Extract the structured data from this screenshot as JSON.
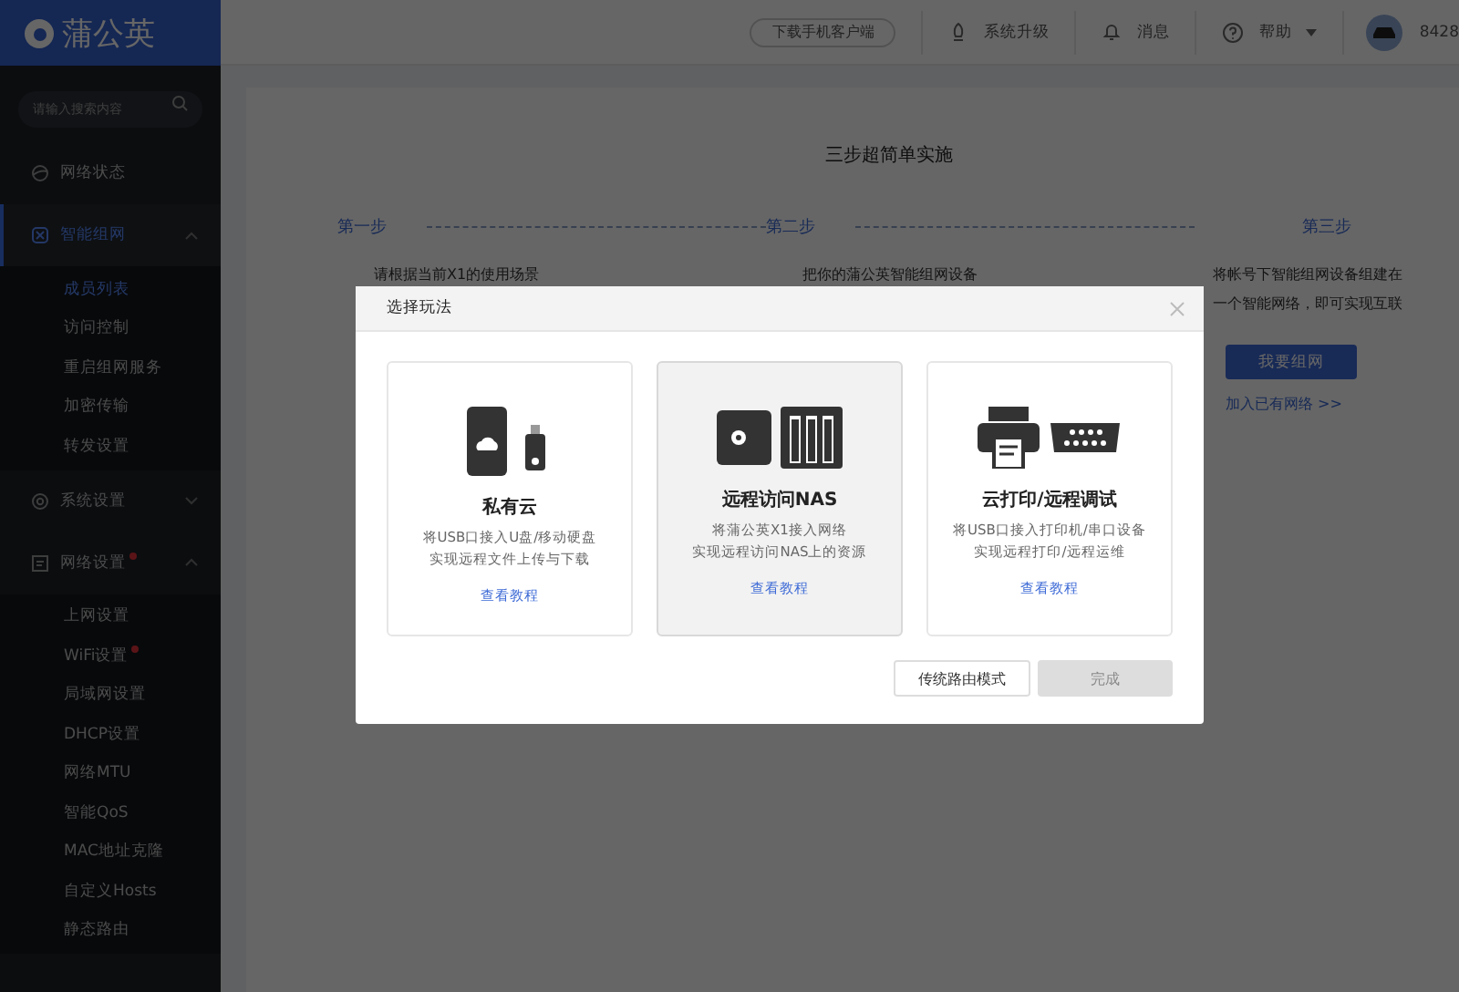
{
  "brand": {
    "name": "蒲公英"
  },
  "search": {
    "placeholder": "请输入搜索内容"
  },
  "topbar": {
    "download": "下载手机客户端",
    "items": [
      {
        "kind": "upgrade",
        "label": "系统升级"
      },
      {
        "kind": "bell",
        "label": "消息"
      },
      {
        "kind": "help",
        "label": "帮助"
      }
    ],
    "user": "8428"
  },
  "sidebar": {
    "items": [
      {
        "label": "网络状态",
        "selected": false,
        "badge": false
      },
      {
        "label": "智能组网",
        "selected": true,
        "expanded": true,
        "badge": false,
        "children": [
          {
            "label": "成员列表",
            "selected": true,
            "badge": false
          },
          {
            "label": "访问控制",
            "selected": false,
            "badge": false
          },
          {
            "label": "重启组网服务",
            "selected": false,
            "badge": false
          },
          {
            "label": "加密传输",
            "selected": false,
            "badge": false
          },
          {
            "label": "转发设置",
            "selected": false,
            "badge": false
          }
        ]
      },
      {
        "label": "系统设置",
        "selected": false,
        "expanded": false,
        "badge": false
      },
      {
        "label": "网络设置",
        "selected": false,
        "expanded": true,
        "badge": true,
        "children": [
          {
            "label": "上网设置",
            "selected": false,
            "badge": false
          },
          {
            "label": "WiFi设置",
            "selected": false,
            "badge": true
          },
          {
            "label": "局域网设置",
            "selected": false,
            "badge": false
          },
          {
            "label": "DHCP设置",
            "selected": false,
            "badge": false
          },
          {
            "label": "网络MTU",
            "selected": false,
            "badge": false
          },
          {
            "label": "智能QoS",
            "selected": false,
            "badge": false
          },
          {
            "label": "MAC地址克隆",
            "selected": false,
            "badge": false
          },
          {
            "label": "自定义Hosts",
            "selected": false,
            "badge": false
          },
          {
            "label": "静态路由",
            "selected": false,
            "badge": false
          }
        ]
      }
    ]
  },
  "main": {
    "title": "三步超简单实施",
    "steps": [
      {
        "label": "第一步",
        "lines": [
          "请根据当前X1的使用场景"
        ]
      },
      {
        "label": "第二步",
        "lines": [
          "把你的蒲公英智能组网设备"
        ]
      },
      {
        "label": "第三步",
        "lines": [
          "将帐号下智能组网设备组建在",
          "一个智能网络，即可实现互联"
        ]
      }
    ],
    "primary_button": "我要组网",
    "join_link": "加入已有网络 >>"
  },
  "dialog": {
    "title": "选择玩法",
    "cards": [
      {
        "kind": "cloud",
        "title": "私有云",
        "lines": [
          "将USB口接入U盘/移动硬盘",
          "实现远程文件上传与下载"
        ],
        "link": "查看教程",
        "selected": false
      },
      {
        "kind": "nas",
        "title": "远程访问NAS",
        "lines": [
          "将蒲公英X1接入网络",
          "实现远程访问NAS上的资源"
        ],
        "link": "查看教程",
        "selected": true
      },
      {
        "kind": "print",
        "title": "云打印/远程调试",
        "lines": [
          "将USB口接入打印机/串口设备",
          "实现远程打印/远程运维"
        ],
        "link": "查看教程",
        "selected": false
      }
    ],
    "buttons": [
      {
        "label": "传统路由模式",
        "disabled": false,
        "kind": "secondary"
      },
      {
        "label": "完成",
        "disabled": true,
        "kind": "primary"
      }
    ]
  }
}
